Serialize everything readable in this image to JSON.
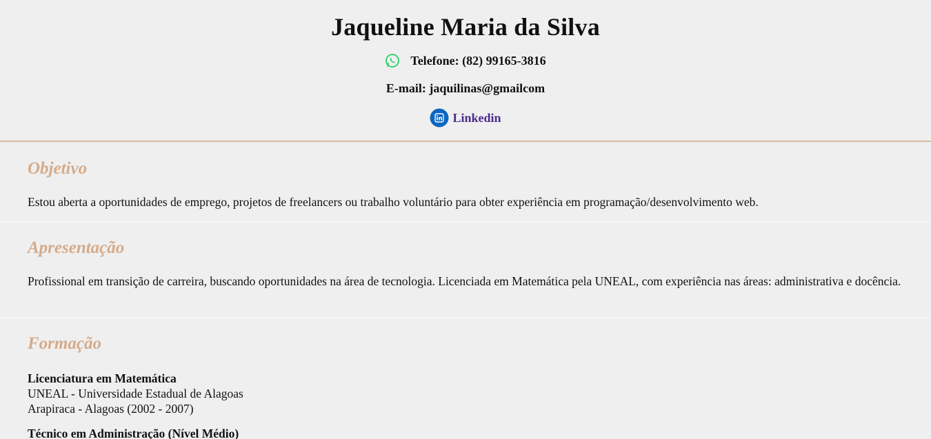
{
  "header": {
    "name": "Jaqueline Maria da Silva",
    "phone": "Telefone: (82) 99165-3816",
    "email": "E-mail: jaquilinas@gmailcom",
    "linkedin_label": "Linkedin"
  },
  "icons": {
    "phone": "whatsapp-icon",
    "linkedin": "linkedin-icon"
  },
  "colors": {
    "accent": "#d5ab8a",
    "link": "#4a2b8c",
    "whatsapp": "#25d366",
    "linkedin": "#0a66c2"
  },
  "sections": {
    "objetivo": {
      "title": "Objetivo",
      "text": "Estou aberta a oportunidades de emprego, projetos de freelancers ou trabalho voluntário para obter experiência em programação/desenvolvimento web."
    },
    "apresentacao": {
      "title": "Apresentação",
      "text": "Profissional em transição de carreira, buscando oportunidades na área de tecnologia. Licenciada em Matemática pela UNEAL, com experiência nas áreas: administrativa e docência."
    },
    "formacao": {
      "title": "Formação",
      "courses": [
        {
          "title": "Licenciatura em Matemática",
          "institution": "UNEAL - Universidade Estadual de Alagoas",
          "location": "Arapiraca - Alagoas (2002 - 2007)"
        },
        {
          "title": "Técnico em Administração (Nível Médio)",
          "institution": "",
          "location": ""
        }
      ]
    }
  }
}
